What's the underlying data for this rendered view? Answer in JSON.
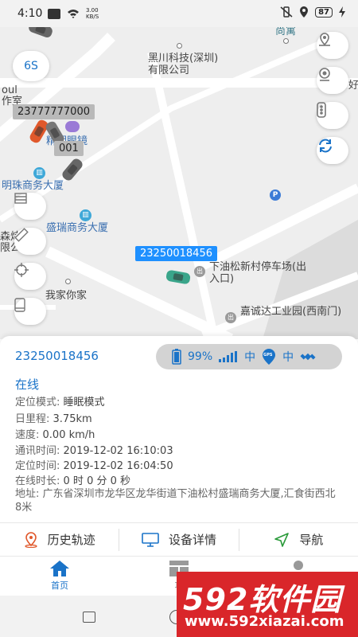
{
  "status_bar": {
    "time": "4:10",
    "net_speed_value": "3.00",
    "net_speed_unit": "KB/S",
    "battery": "87"
  },
  "map": {
    "zoom_label": "6S",
    "labels": {
      "heichuan": "黑川科技(深圳)有限公司",
      "shangyu": "尚寓",
      "left_edge_1": "oul",
      "left_edge_2": "作室",
      "glasses": "精明眼镜",
      "mingzhu": "明珠商务大厦",
      "shengrui": "盛瑞商务大厦",
      "left_edge_3": "森炜",
      "left_edge_4": "限公",
      "parking": "下油松新村停车场(出入口)",
      "jiajia": "我家你家",
      "jiacheng": "嘉诚达工业园(西南门)",
      "right_edge": "好"
    },
    "tags": {
      "car1": "23777777000",
      "car2": "001",
      "selected": "23250018456"
    },
    "poi_symbols": {
      "parking": "P",
      "gate": "出"
    }
  },
  "panel": {
    "device_id": "23250018456",
    "battery_percent": "99%",
    "signal_text": "中",
    "gps_label": "GPS",
    "gps_text": "中",
    "online_status": "在线",
    "rows": [
      {
        "label": "定位模式:",
        "value": "睡眠模式"
      },
      {
        "label": "日里程:",
        "value": "3.75km"
      },
      {
        "label": "速度:",
        "value": "0.00 km/h"
      },
      {
        "label": "通讯时间:",
        "value": "2019-12-02 16:10:03"
      },
      {
        "label": "定位时间:",
        "value": "2019-12-02 16:04:50"
      },
      {
        "label": "在线时长:",
        "value": "0 时 0 分 0 秒"
      }
    ],
    "address_label": "地址:",
    "address": "广东省深圳市龙华区龙华街道下油松村盛瑞商务大厦,汇食街西北8米"
  },
  "actions": {
    "history": "历史轨迹",
    "details": "设备详情",
    "navigate": "导航"
  },
  "tabs": {
    "home": "首页",
    "function": "功"
  },
  "watermark": {
    "top": "592软件园",
    "bottom": "www.592xiazai.com"
  },
  "colors": {
    "accent": "#1a73c8",
    "car_green": "#3aa58a",
    "car_orange": "#e0582b",
    "tag_blue": "#1e90ff",
    "watermark": "#d9262a"
  }
}
